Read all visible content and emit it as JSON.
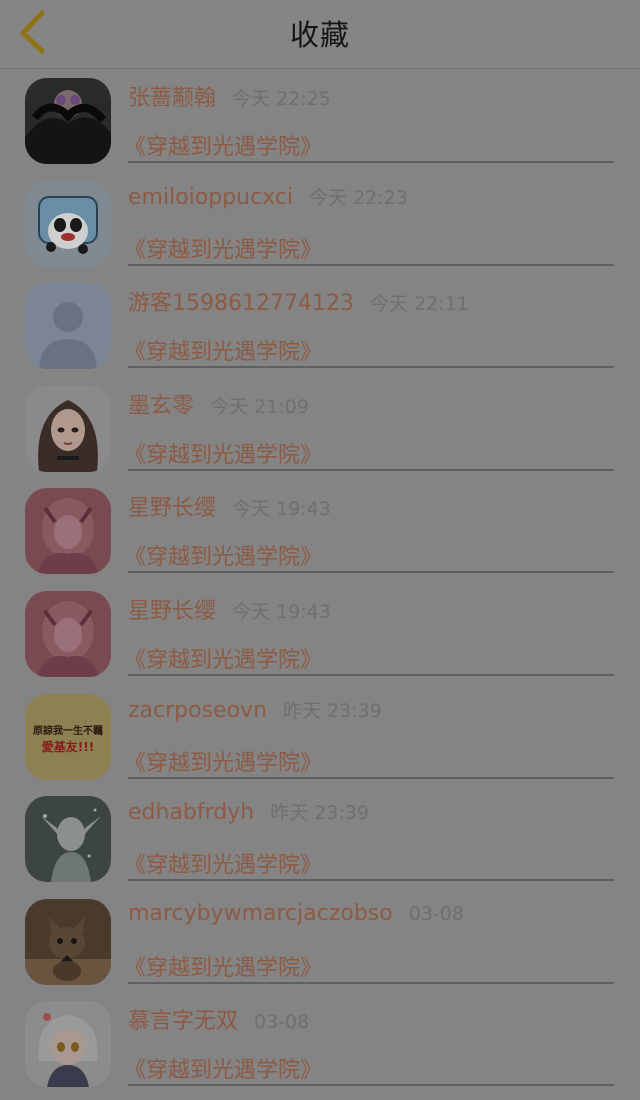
{
  "header": {
    "title": "收藏"
  },
  "list": [
    {
      "name": "张蔷颟翰",
      "time": "今天 22:25",
      "book": "《穿越到光遇学院》",
      "avatar": "dark-figure-avatar"
    },
    {
      "name": "emiloioppucxci",
      "time": "今天 22:23",
      "book": "《穿越到光遇学院》",
      "avatar": "panda-avatar"
    },
    {
      "name": "游客1598612774123",
      "time": "今天 22:11",
      "book": "《穿越到光遇学院》",
      "avatar": "default-user-avatar"
    },
    {
      "name": "墨玄零",
      "time": "今天 21:09",
      "book": "《穿越到光遇学院》",
      "avatar": "anime-girl-avatar"
    },
    {
      "name": "星野长缨",
      "time": "今天 19:43",
      "book": "《穿越到光遇学院》",
      "avatar": "pink-anime-avatar"
    },
    {
      "name": "星野长缨",
      "time": "今天 19:43",
      "book": "《穿越到光遇学院》",
      "avatar": "pink-anime-avatar"
    },
    {
      "name": "zacrposeovn",
      "time": "昨天 23:39",
      "book": "《穿越到光遇学院》",
      "avatar": "text-avatar",
      "avatar_text_1": "原諒我一生不羈",
      "avatar_text_2": "愛基友!!!"
    },
    {
      "name": "edhabfrdyh",
      "time": "昨天 23:39",
      "book": "《穿越到光遇学院》",
      "avatar": "elf-avatar"
    },
    {
      "name": "marcybywmarcjaczobso",
      "time": "03-08",
      "book": "《穿越到光遇学院》",
      "avatar": "cat-avatar"
    },
    {
      "name": "慕言字无双",
      "time": "03-08",
      "book": "《穿越到光遇学院》",
      "avatar": "chibi-avatar"
    }
  ],
  "colors": {
    "overlay_background": "#848484",
    "accent_text": "#8d5a44",
    "back_chevron": "#8f7417"
  }
}
